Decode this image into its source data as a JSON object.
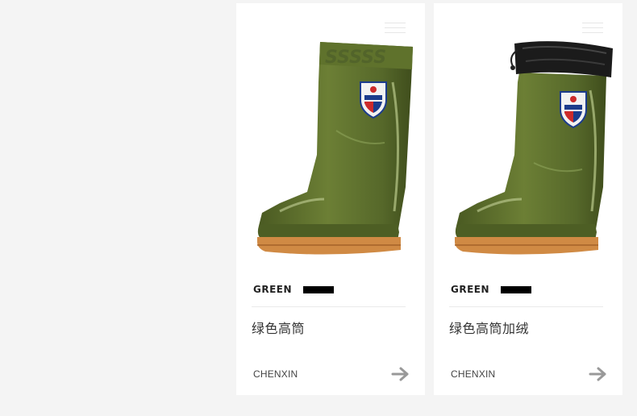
{
  "cards": [
    {
      "color_label": "GREEN",
      "product_name": "绿色高筒",
      "brand": "CHENXIN",
      "collar": "plain"
    },
    {
      "color_label": "GREEN",
      "product_name": "绿色高筒加绒",
      "brand": "CHENXIN",
      "collar": "fleece"
    }
  ],
  "colors": {
    "boot_green": "#5c6e2e",
    "sole_orange": "#d08a44",
    "background": "#f4f4f4",
    "card": "#ffffff"
  },
  "icons": [
    "menu-icon",
    "arrow-right-icon",
    "badge-icon"
  ]
}
